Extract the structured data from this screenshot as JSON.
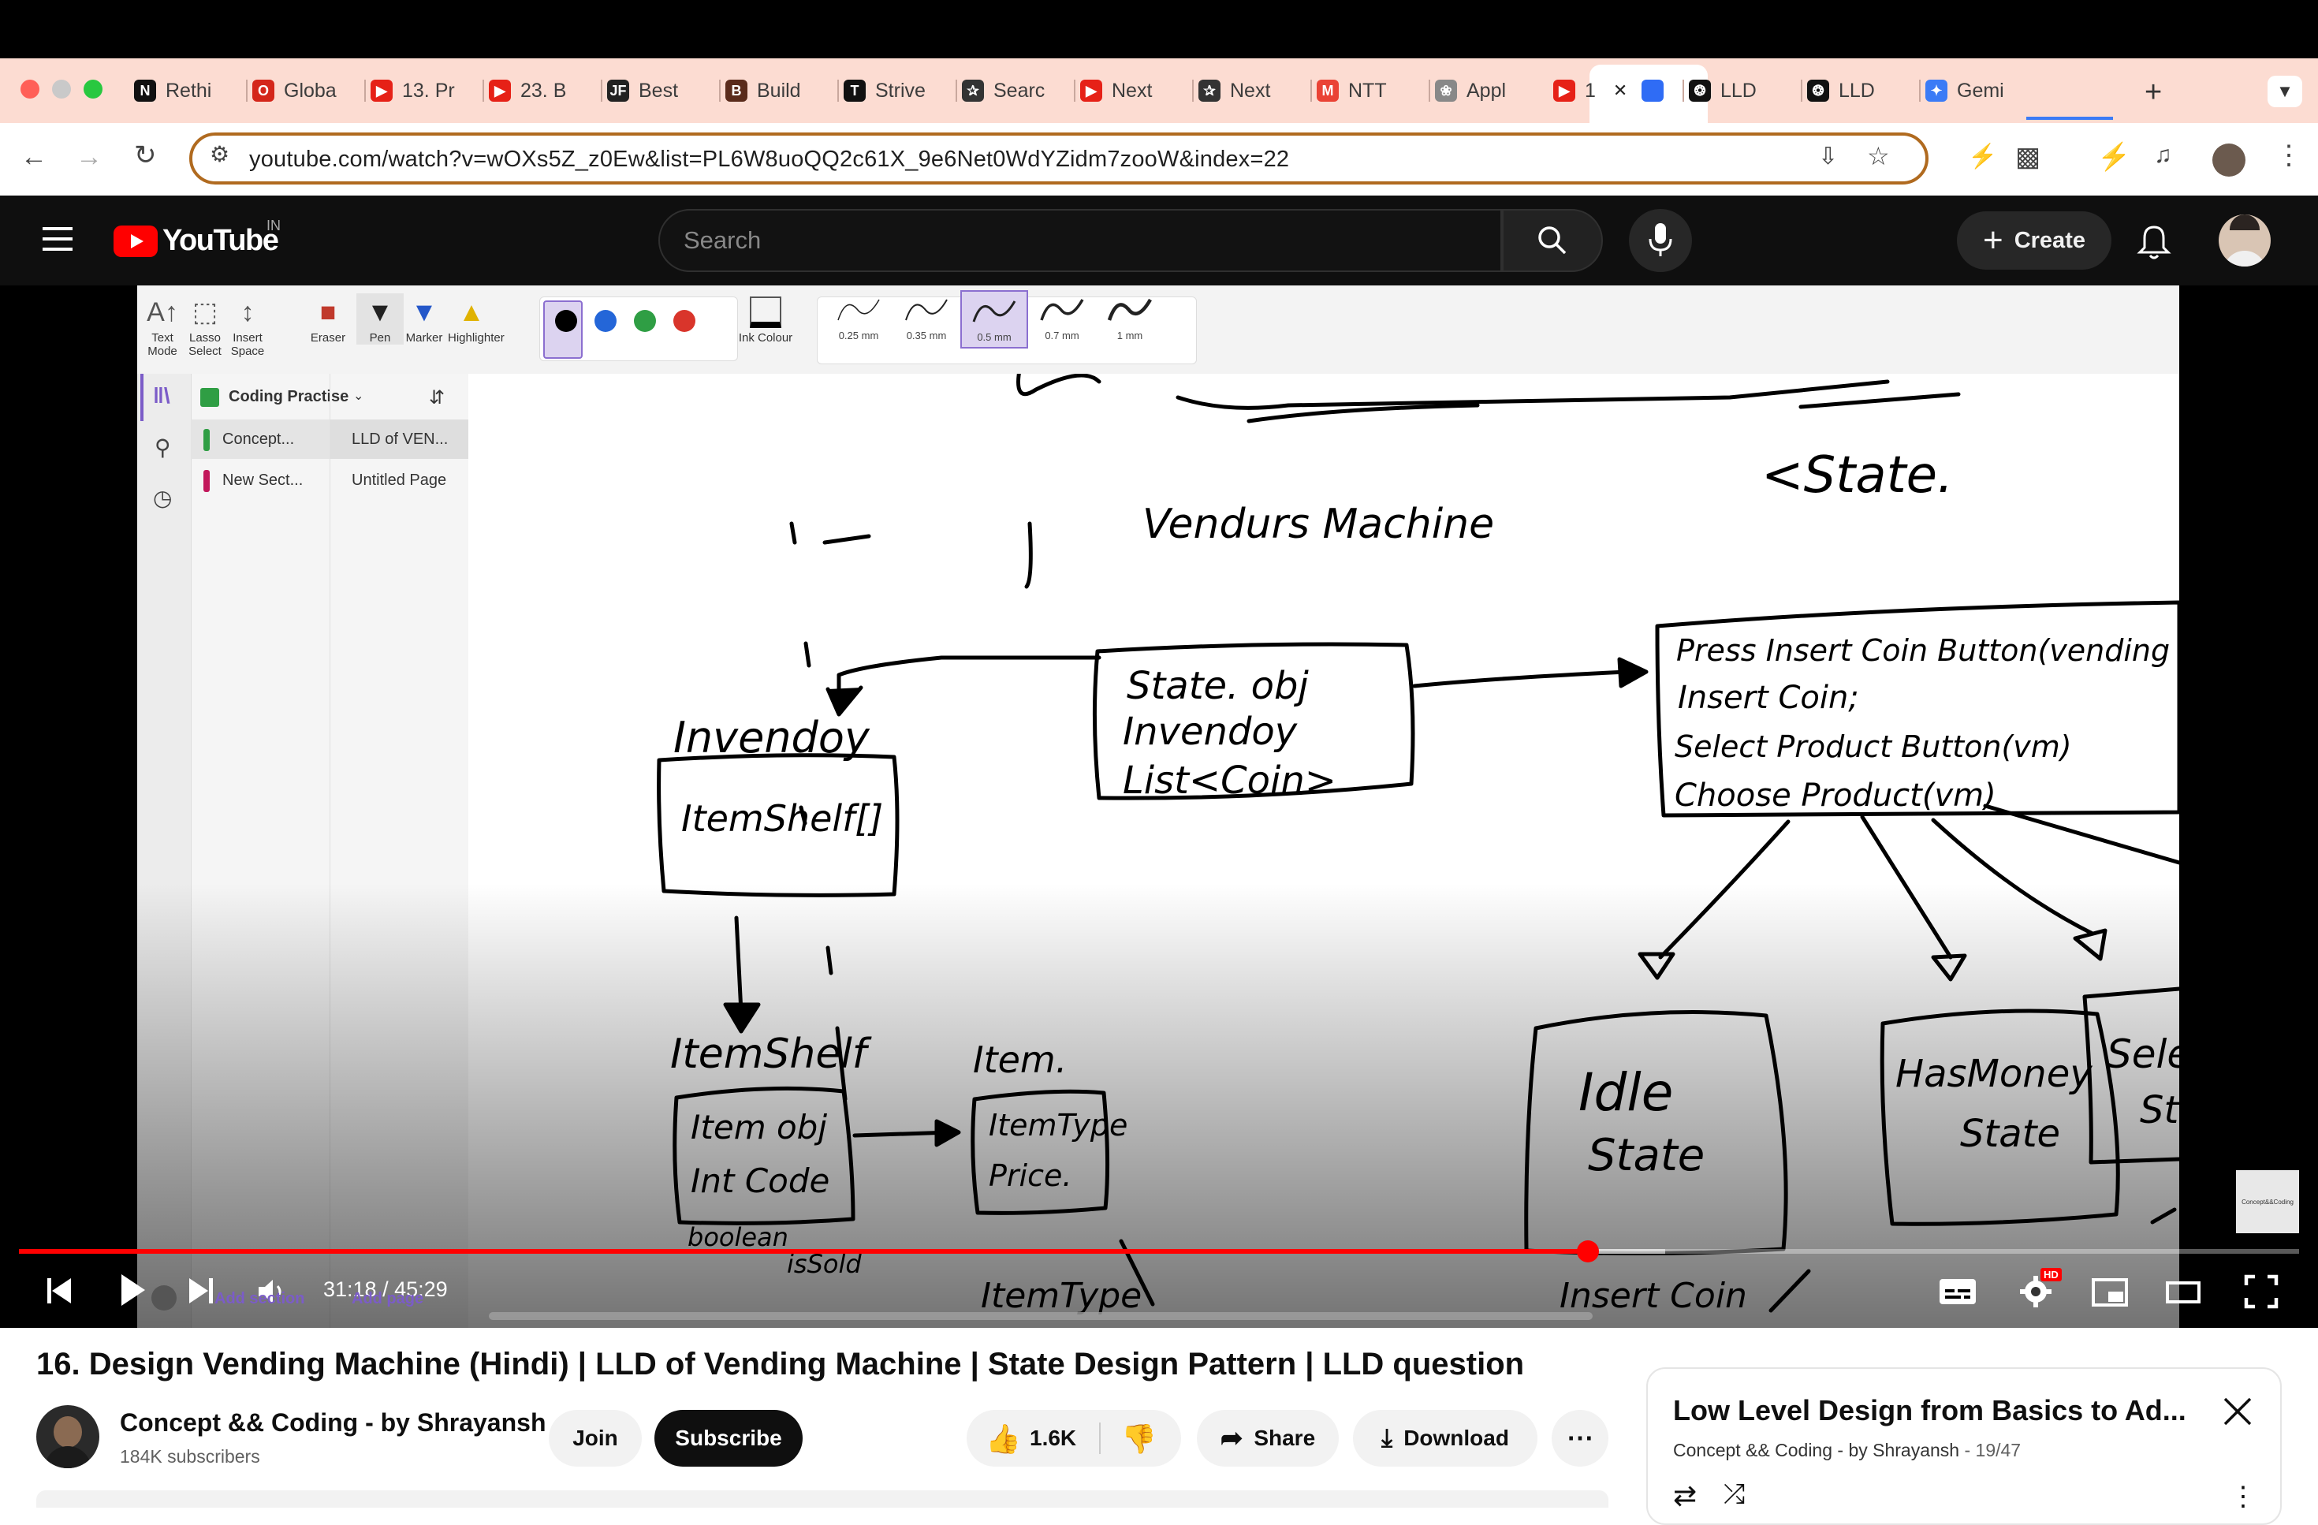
{
  "browser": {
    "tabs": [
      {
        "label": "Rethi",
        "icon": "notion-icon",
        "color": "#111111"
      },
      {
        "label": "Globa",
        "icon": "ring-icon",
        "color": "#d4261a"
      },
      {
        "label": "13. Pr",
        "icon": "youtube-icon",
        "color": "#e62117"
      },
      {
        "label": "23. B",
        "icon": "youtube-icon",
        "color": "#e62117"
      },
      {
        "label": "Best",
        "icon": "jf-icon",
        "color": "#222222"
      },
      {
        "label": "Build",
        "icon": "builder-icon",
        "color": "#5a2b1b"
      },
      {
        "label": "Strive",
        "icon": "tuf-icon",
        "color": "#111111"
      },
      {
        "label": "Searc",
        "icon": "quill-icon",
        "color": "#333333"
      },
      {
        "label": "Next",
        "icon": "youtube-icon",
        "color": "#e62117"
      },
      {
        "label": "Next",
        "icon": "quill-icon",
        "color": "#333333"
      },
      {
        "label": "NTT",
        "icon": "gmail-icon",
        "color": "#ea4335"
      },
      {
        "label": "Appl",
        "icon": "figma-icon",
        "color": "#888888"
      },
      {
        "label": "1",
        "icon": "youtube-icon",
        "color": "#e62117"
      },
      {
        "label": "",
        "icon": "blue-square-icon",
        "color": "#2f6cf5"
      },
      {
        "label": "LLD",
        "icon": "openai-icon",
        "color": "#111111"
      },
      {
        "label": "LLD",
        "icon": "openai-alt-icon",
        "color": "#111111"
      },
      {
        "label": "Gemi",
        "icon": "gemini-icon",
        "color": "#3b7bf6"
      }
    ],
    "url": "youtube.com/watch?v=wOXs5Z_z0Ew&list=PL6W8uoQQ2c61X_9e6Net0WdYZidm7zooW&index=22"
  },
  "youtube": {
    "logo_text": "YouTube",
    "region": "IN",
    "search_placeholder": "Search",
    "create_label": "Create"
  },
  "onenote": {
    "tools": [
      {
        "label": "Text Mode",
        "icon": "text-mode-icon"
      },
      {
        "label": "Lasso Select",
        "icon": "lasso-icon"
      },
      {
        "label": "Insert Space",
        "icon": "insert-space-icon"
      },
      {
        "label": "Eraser",
        "icon": "eraser-icon"
      },
      {
        "label": "Pen",
        "icon": "pen-icon"
      },
      {
        "label": "Marker",
        "icon": "marker-icon"
      },
      {
        "label": "Highlighter",
        "icon": "highlighter-icon"
      }
    ],
    "ink_colours": [
      "#000000",
      "#2466d8",
      "#2f9e44",
      "#d9352b"
    ],
    "ink_colour_label": "Ink Colour",
    "pen_widths": [
      "0.25 mm",
      "0.35 mm",
      "0.5 mm",
      "0.7 mm",
      "1 mm"
    ],
    "selected_width": "0.5 mm",
    "notebook": "Coding Practise",
    "sections": [
      {
        "name": "Concept...",
        "color": "#2f9e44"
      },
      {
        "name": "New Sect...",
        "color": "#c2185b"
      }
    ],
    "pages": [
      "LLD of VEN...",
      "Untitled Page"
    ],
    "add_section": "Add section",
    "add_page": "Add page"
  },
  "player": {
    "current_time": "31:18",
    "duration": "45:29",
    "time_display": "31:18 / 45:29",
    "progress_fraction": 0.688,
    "buffered_fraction": 0.722,
    "hd_badge": "HD",
    "watermark": "Concept&&Coding"
  },
  "video": {
    "title": "16. Design Vending Machine (Hindi) | LLD of Vending Machine | State Design Pattern | LLD question",
    "channel": "Concept && Coding - by Shrayansh",
    "subscribers": "184K subscribers",
    "join_label": "Join",
    "subscribe_label": "Subscribe",
    "likes": "1.6K",
    "share_label": "Share",
    "download_label": "Download"
  },
  "playlist": {
    "title": "Low Level Design from Basics to Ad...",
    "owner": "Concept && Coding - by Shrayansh",
    "position": "19/47"
  }
}
